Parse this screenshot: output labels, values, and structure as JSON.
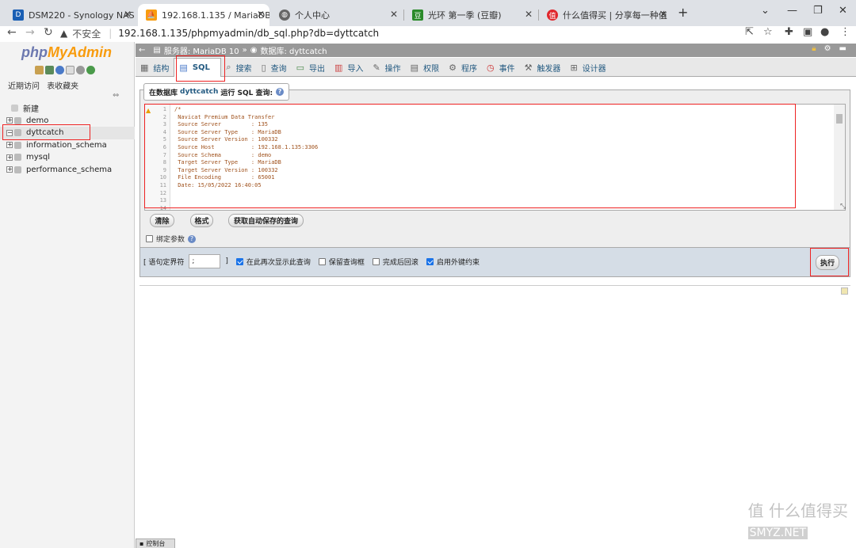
{
  "browser": {
    "tabs": [
      {
        "title": "DSM220 - Synology NAS",
        "active": false
      },
      {
        "title": "192.168.1.135 / MariaDB 10 / ",
        "active": true
      },
      {
        "title": "个人中心",
        "active": false
      },
      {
        "title": "光环 第一季 (豆瓣)",
        "active": false
      },
      {
        "title": "什么值得买 | 分享每一种值",
        "active": false
      }
    ],
    "not_secure": "不安全",
    "url": "192.168.1.135/phpmyadmin/db_sql.php?db=dyttcatch"
  },
  "sidebar": {
    "logo_php": "php",
    "logo_myadmin": "MyAdmin",
    "recent": "近期访问",
    "favorites": "表收藏夹",
    "new_label": "新建",
    "databases": [
      "demo",
      "dyttcatch",
      "information_schema",
      "mysql",
      "performance_schema"
    ],
    "selected": "dyttcatch"
  },
  "breadcrumb": {
    "server": "服务器: MariaDB 10",
    "sep": "»",
    "database": "数据库: dyttcatch"
  },
  "tabs": [
    {
      "label": "结构",
      "icon": "structure-icon"
    },
    {
      "label": "SQL",
      "icon": "sql-icon",
      "active": true
    },
    {
      "label": "搜索",
      "icon": "search-icon"
    },
    {
      "label": "查询",
      "icon": "query-icon"
    },
    {
      "label": "导出",
      "icon": "export-icon"
    },
    {
      "label": "导入",
      "icon": "import-icon"
    },
    {
      "label": "操作",
      "icon": "operations-icon"
    },
    {
      "label": "权限",
      "icon": "privileges-icon"
    },
    {
      "label": "程序",
      "icon": "routines-icon"
    },
    {
      "label": "事件",
      "icon": "events-icon"
    },
    {
      "label": "触发器",
      "icon": "triggers-icon"
    },
    {
      "label": "设计器",
      "icon": "designer-icon"
    }
  ],
  "sql_panel": {
    "legend_prefix": "在数据库",
    "legend_db": "dyttcatch",
    "legend_suffix": "运行 SQL 查询:",
    "code_lines": [
      "/*",
      " Navicat Premium Data Transfer",
      "",
      " Source Server         : 135",
      " Source Server Type    : MariaDB",
      " Source Server Version : 100332",
      " Source Host           : 192.168.1.135:3306",
      " Source Schema         : demo",
      "",
      " Target Server Type    : MariaDB",
      " Target Server Version : 100332",
      " File Encoding         : 65001",
      "",
      " Date: 15/05/2022 16:40:05"
    ],
    "btn_clear": "清除",
    "btn_format": "格式",
    "btn_autosaved": "获取自动保存的查询",
    "bind_params": "绑定参数"
  },
  "options": {
    "delimiter_label": "[ 语句定界符",
    "delimiter_value": ";",
    "delimiter_end": "]",
    "show_again": "在此再次显示此查询",
    "keep_box": "保留查询框",
    "rollback": "完成后回滚",
    "foreign_keys": "启用外键约束",
    "execute": "执行"
  },
  "console": "控制台",
  "watermark": {
    "brand": "值 什么值得买",
    "tag": "SMYZ.NET"
  }
}
